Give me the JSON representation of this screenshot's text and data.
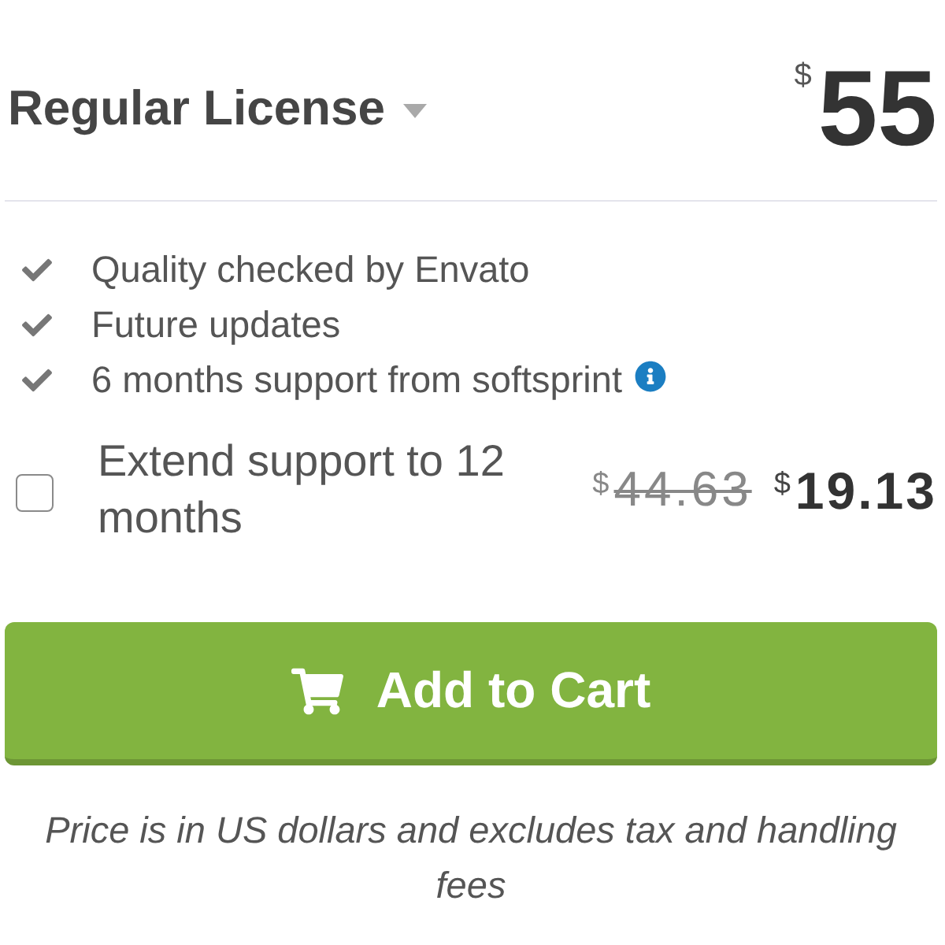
{
  "license": {
    "title": "Regular License",
    "currency": "$",
    "price": "55"
  },
  "features": [
    {
      "label": "Quality checked by Envato",
      "info": false
    },
    {
      "label": "Future updates",
      "info": false
    },
    {
      "label": "6 months support from softsprint",
      "info": true
    }
  ],
  "extended_support": {
    "label": "Extend support to 12 months",
    "checked": false,
    "old_currency": "$",
    "old_price": "44.63",
    "currency": "$",
    "price": "19.13"
  },
  "button": {
    "label": "Add to Cart"
  },
  "note": "Price is in US dollars and excludes tax and handling fees"
}
